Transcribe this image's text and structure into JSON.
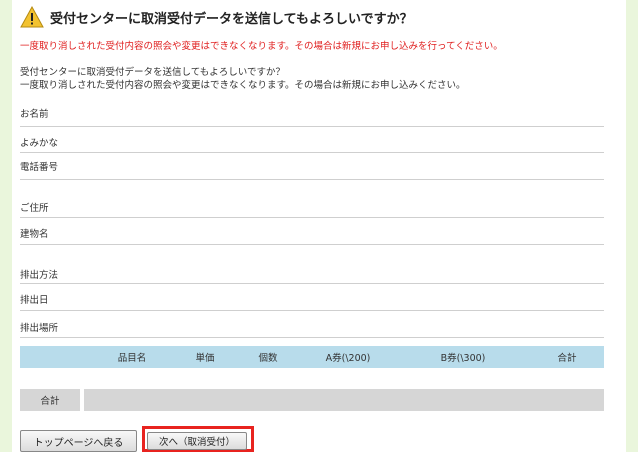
{
  "header": {
    "title": "受付センターに取消受付データを送信してもよろしいですか？",
    "warning_icon": "warning-triangle-icon"
  },
  "notice": "一度取り消しされた受付内容の照会や変更はできなくなります。その場合は新規にお申し込みを行ってください。",
  "confirm": {
    "line1": "受付センターに取消受付データを送信してもよろしいですか？",
    "line2": "一度取り消しされた受付内容の照会や変更はできなくなります。その場合は新規にお申し込みください。"
  },
  "fields": [
    {
      "label": "お名前"
    },
    {
      "label": "よみかな"
    },
    {
      "label": "電話番号"
    },
    {
      "label": "ご住所"
    },
    {
      "label": "建物名"
    },
    {
      "label": "排出方法"
    },
    {
      "label": "排出日"
    },
    {
      "label": "排出場所"
    }
  ],
  "items_table": {
    "headers": [
      "",
      "品目名",
      "単価",
      "個数",
      "A券(\\200)",
      "B券(\\300)",
      "合計"
    ]
  },
  "total": {
    "label": "合計"
  },
  "buttons": {
    "back": "トップページへ戻る",
    "next": "次へ（取消受付）"
  },
  "colors": {
    "accent_red": "#e02020",
    "table_header": "#b8dceb",
    "side_green": "#eaf6dc",
    "highlight": "#e8231f"
  }
}
